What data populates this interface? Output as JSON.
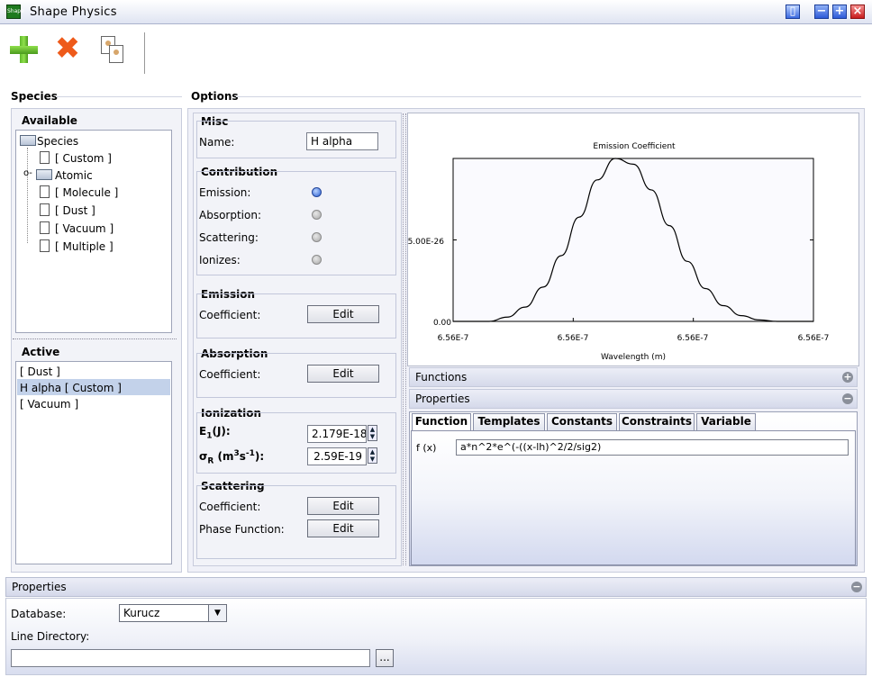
{
  "window": {
    "title": "Shape  Physics",
    "icon_text": "Shape"
  },
  "species": {
    "heading": "Species",
    "available_title": "Available",
    "tree": {
      "root": "Species",
      "items": [
        "[ Custom ]",
        "Atomic",
        "[ Molecule ]",
        "[ Dust ]",
        "[ Vacuum ]",
        "[ Multiple ]"
      ]
    },
    "active_title": "Active",
    "active_items": [
      "[ Dust ]",
      "H alpha [ Custom ]",
      "[ Vacuum ]"
    ]
  },
  "options": {
    "heading": "Options",
    "misc": {
      "title": "Misc",
      "name_label": "Name:",
      "name_value": "H alpha"
    },
    "contribution": {
      "title": "Contribution",
      "items": [
        {
          "label": "Emission:",
          "checked": true
        },
        {
          "label": "Absorption:",
          "checked": false
        },
        {
          "label": "Scattering:",
          "checked": false
        },
        {
          "label": "Ionizes:",
          "checked": false
        }
      ]
    },
    "emission": {
      "title": "Emission",
      "coef_label": "Coefficient:",
      "button": "Edit"
    },
    "absorption": {
      "title": "Absorption",
      "coef_label": "Coefficient:",
      "button": "Edit"
    },
    "ionization": {
      "title": "Ionization",
      "e1_base": "E",
      "e1_sub": "1",
      "e1_rest": "(J):",
      "e1_value": "2.179E-18",
      "sigma_base": "σ",
      "sigma_sub": "R",
      "sigma_m": " (m",
      "sigma_sup1": "3",
      "sigma_s": "s",
      "sigma_sup2": "-1",
      "sigma_end": "):",
      "sigma_value": "2.59E-19"
    },
    "scattering": {
      "title": "Scattering",
      "coef_label": "Coefficient:",
      "phase_label": "Phase Function:",
      "button": "Edit",
      "button2": "Edit"
    }
  },
  "chart_data": {
    "type": "line",
    "title": "Emission Coefficient",
    "xlabel": "Wavelength (m)",
    "ylabel": "",
    "x_ticks": [
      "6.56E-7",
      "6.56E-7",
      "6.56E-7",
      "6.56E-7"
    ],
    "y_ticks": [
      "0.00",
      "5.00E-26"
    ],
    "series": [
      {
        "x": [
          0.0,
          0.05,
          0.1,
          0.15,
          0.2,
          0.25,
          0.3,
          0.35,
          0.4,
          0.45,
          0.5,
          0.55,
          0.6,
          0.65,
          0.7,
          0.75,
          0.8,
          0.85,
          0.9,
          0.95,
          1.0
        ],
        "y": [
          0.0,
          0.0,
          0.0,
          0.3,
          1.0,
          2.4,
          4.6,
          7.3,
          9.9,
          11.4,
          11.0,
          9.2,
          6.7,
          4.2,
          2.3,
          1.1,
          0.4,
          0.1,
          0.0,
          0.0,
          0.0
        ]
      }
    ],
    "ylim": [
      0,
      10
    ],
    "grid": false,
    "legend": "none"
  },
  "functions_bar": {
    "label": "Functions",
    "sign": "+"
  },
  "properties_bar": {
    "label": "Properties",
    "sign": "−"
  },
  "tabs": [
    "Function",
    "Templates",
    "Constants",
    "Constraints",
    "Variable"
  ],
  "function_row": {
    "label": "f (x)",
    "value": "a*n^2*e^(-((x-lh)^2/2/sig2)"
  },
  "bottom_properties": {
    "label": "Properties",
    "sign": "−",
    "database_label": "Database:",
    "database_value": "Kurucz",
    "line_dir_label": "Line Directory:",
    "line_dir_value": "",
    "browse_label": "..."
  }
}
